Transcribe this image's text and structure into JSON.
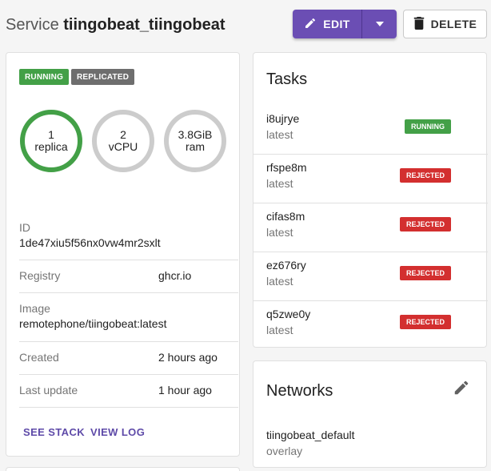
{
  "header": {
    "title_prefix": "Service",
    "service_name": "tiingobeat_tiingobeat",
    "edit_label": "EDIT",
    "delete_label": "DELETE"
  },
  "service": {
    "badges": [
      {
        "label": "RUNNING",
        "color": "#43a047"
      },
      {
        "label": "REPLICATED",
        "color": "#6e6e6e"
      }
    ],
    "gauges": [
      {
        "value": "1",
        "unit": "replica",
        "fill": 1.0,
        "color": "#43a047"
      },
      {
        "value": "2",
        "unit": "vCPU",
        "fill": 1.0,
        "color": "#cccccc"
      },
      {
        "value": "3.8GiB",
        "unit": "ram",
        "fill": 1.0,
        "color": "#cccccc"
      }
    ],
    "fields": {
      "id_label": "ID",
      "id_value": "1de47xiu5f56nx0vw4mr2sxlt",
      "registry_label": "Registry",
      "registry_value": "ghcr.io",
      "image_label": "Image",
      "image_value": "remotephone/tiingobeat:latest",
      "created_label": "Created",
      "created_value": "2 hours ago",
      "updated_label": "Last update",
      "updated_value": "1 hour ago"
    },
    "links": {
      "see_stack": "SEE STACK",
      "view_log": "VIEW LOG"
    }
  },
  "tasks": {
    "title": "Tasks",
    "items": [
      {
        "id": "i8ujrye",
        "version": "latest",
        "status": "RUNNING",
        "color": "#43a047"
      },
      {
        "id": "rfspe8m",
        "version": "latest",
        "status": "REJECTED",
        "color": "#d32f2f"
      },
      {
        "id": "cifas8m",
        "version": "latest",
        "status": "REJECTED",
        "color": "#d32f2f"
      },
      {
        "id": "ez676ry",
        "version": "latest",
        "status": "REJECTED",
        "color": "#d32f2f"
      },
      {
        "id": "q5zwe0y",
        "version": "latest",
        "status": "REJECTED",
        "color": "#d32f2f"
      }
    ]
  },
  "networks": {
    "title": "Networks",
    "items": [
      {
        "name": "tiingobeat_default",
        "driver": "overlay"
      }
    ]
  },
  "icons": {
    "edit": "pencil-icon",
    "dropdown": "caret-down-icon",
    "delete": "trash-icon",
    "network_edit": "pencil-icon"
  },
  "colors": {
    "accent": "#6b4eb4",
    "link": "#5e4aa8"
  }
}
